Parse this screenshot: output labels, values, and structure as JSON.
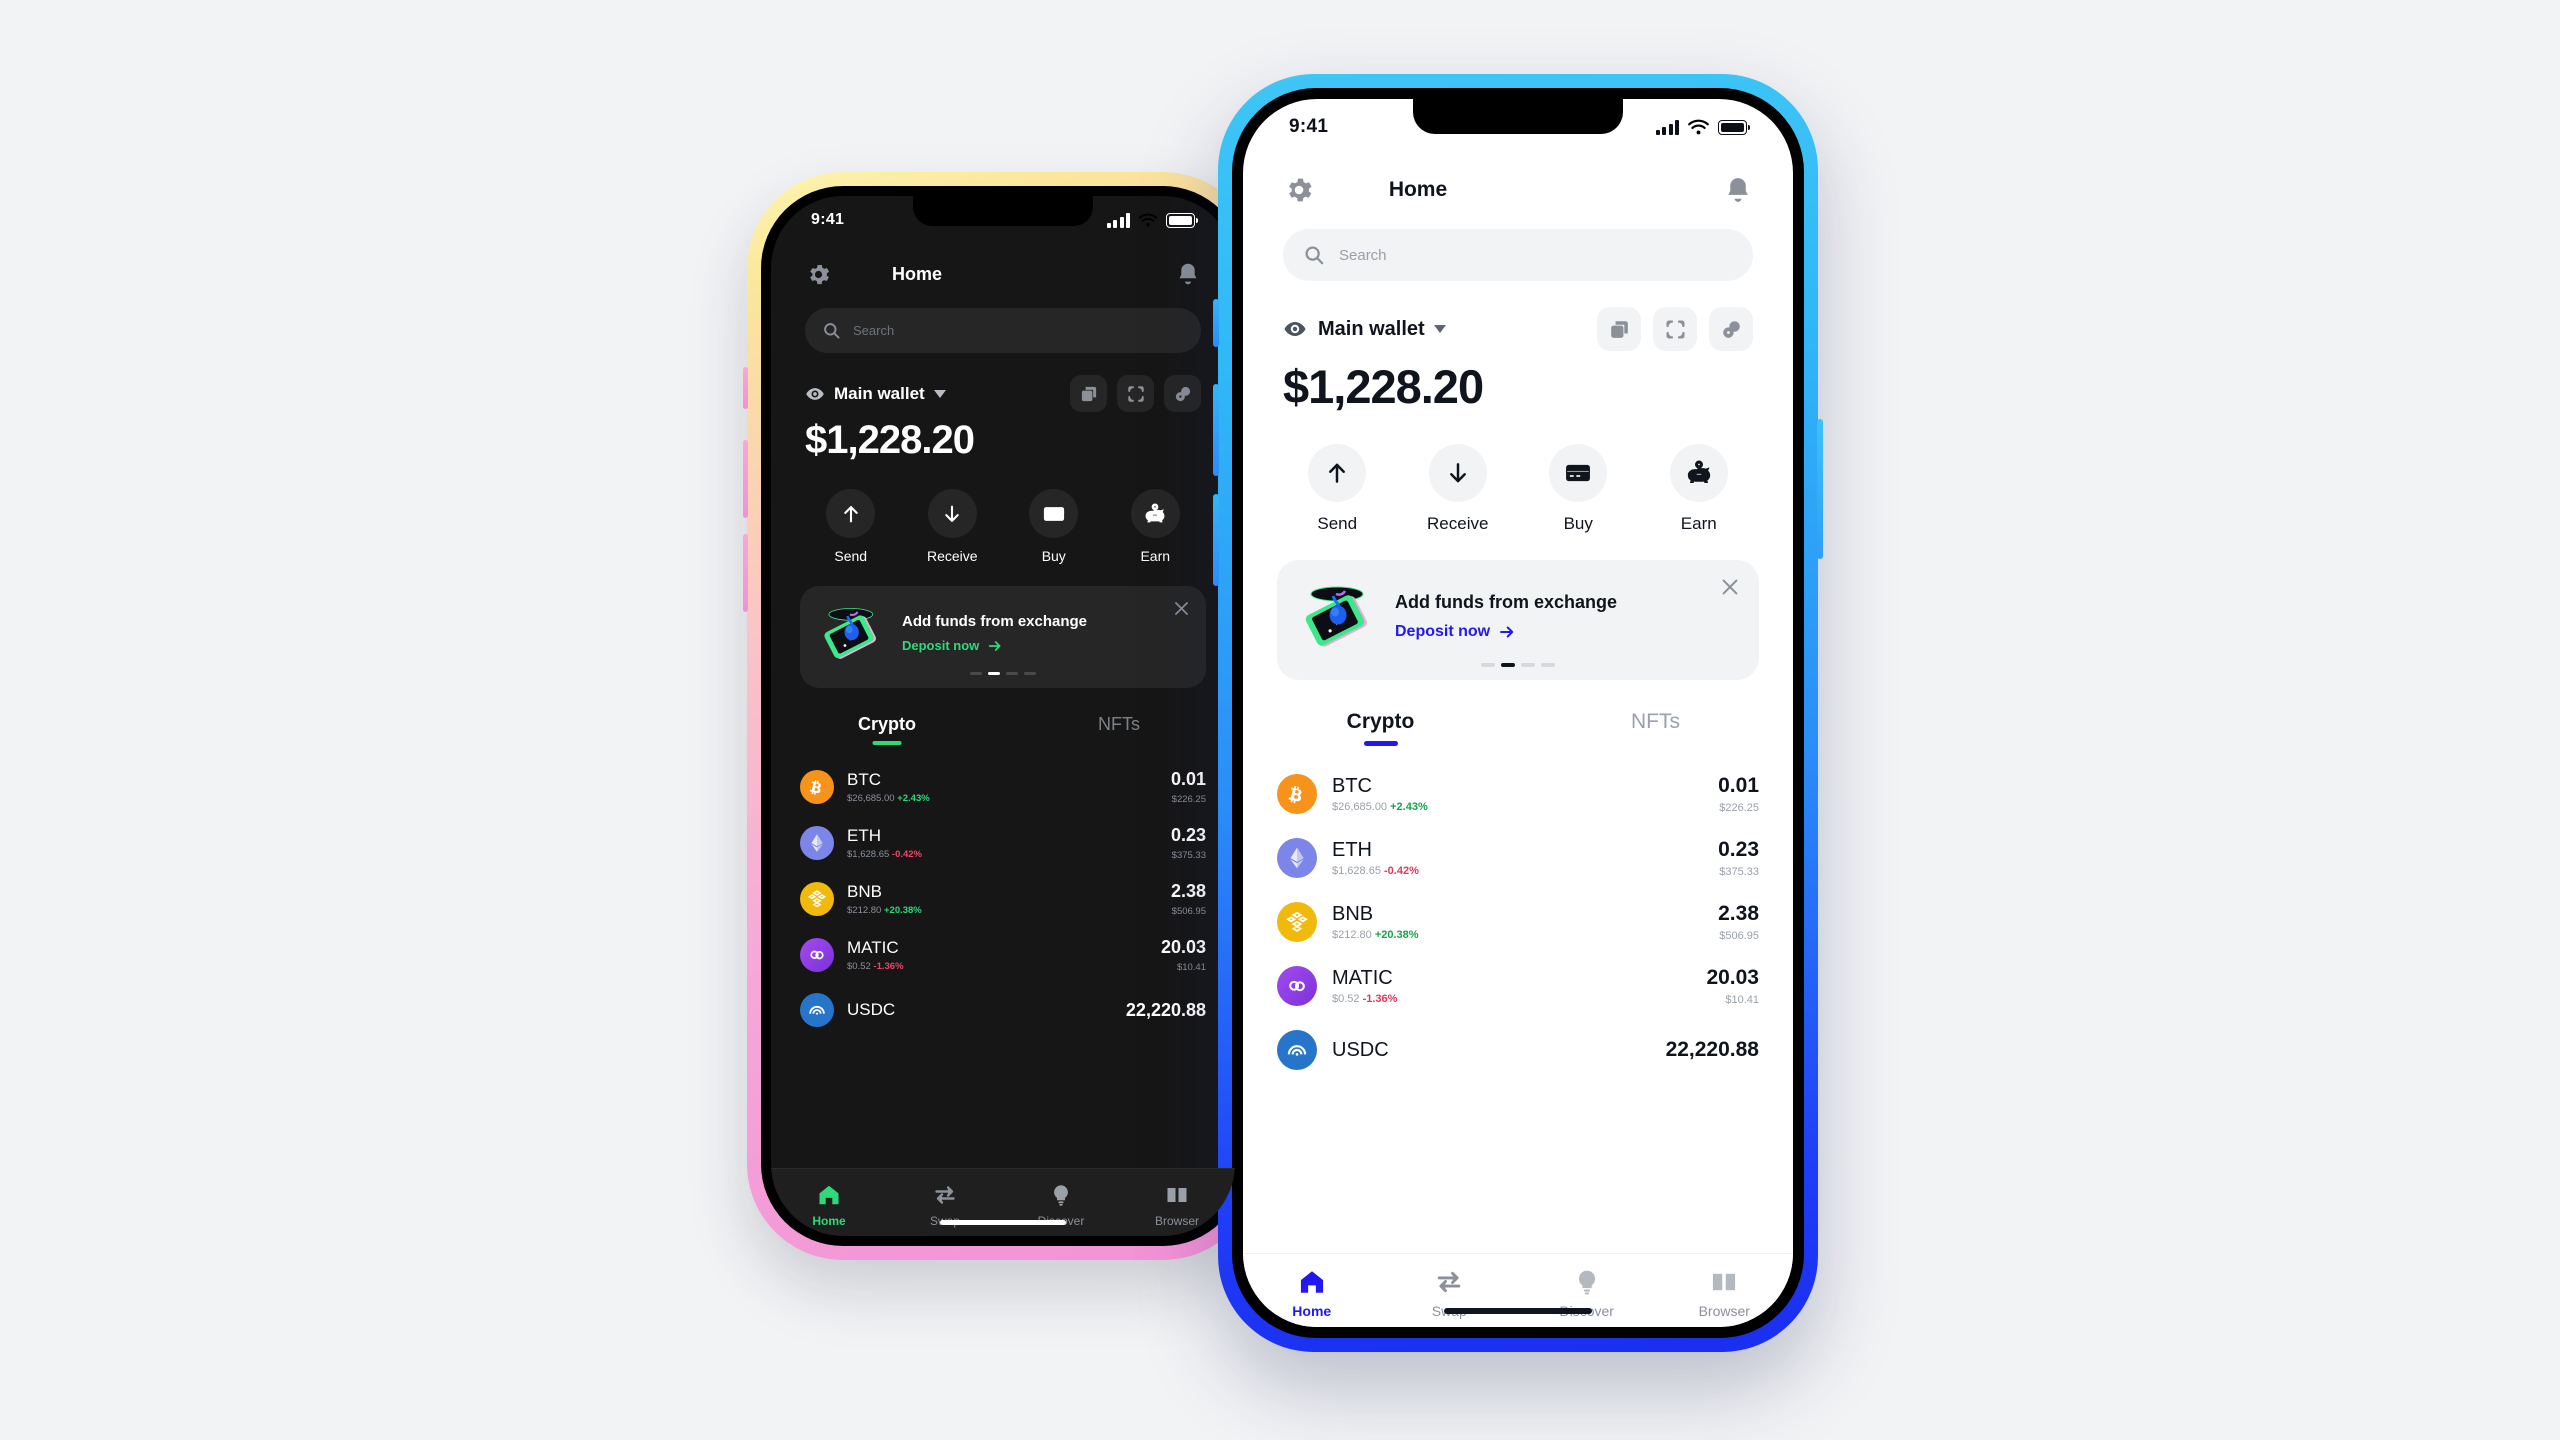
{
  "theme_colors": {
    "light_accent": "#2119ee",
    "dark_accent": "#2fd97a",
    "positive": "#16a34a",
    "negative": "#e0385a",
    "page_background": "#f2f3f5",
    "light_screen_bg": "#ffffff",
    "dark_screen_bg": "#161616",
    "dark_phone_frame": "yellow-to-pink gradient",
    "light_phone_frame": "cyan-to-blue gradient"
  },
  "status_bar": {
    "time": "9:41",
    "signal_icon": "cellular-bars-icon",
    "wifi_icon": "wifi-icon",
    "battery_icon": "battery-full-icon"
  },
  "header": {
    "title": "Home",
    "settings_icon": "gear-icon",
    "notifications_icon": "bell-icon"
  },
  "search": {
    "placeholder": "Search",
    "value": "",
    "icon": "search-icon"
  },
  "wallet": {
    "visibility_icon": "eye-icon",
    "name": "Main wallet",
    "dropdown_icon": "chevron-down-icon",
    "balance": "$1,228.20",
    "actions": [
      {
        "name": "copy-address-button",
        "icon": "copy-icon"
      },
      {
        "name": "scan-qr-button",
        "icon": "qr-scan-icon"
      },
      {
        "name": "connect-button",
        "icon": "link-connect-icon"
      }
    ]
  },
  "quick_actions": [
    {
      "label": "Send",
      "icon": "arrow-up-icon"
    },
    {
      "label": "Receive",
      "icon": "arrow-down-icon"
    },
    {
      "label": "Buy",
      "icon": "credit-card-icon"
    },
    {
      "label": "Earn",
      "icon": "piggy-bank-icon"
    }
  ],
  "promo": {
    "title": "Add funds from exchange",
    "cta": "Deposit now",
    "cta_arrow": "arrow-right-icon",
    "close_icon": "close-icon",
    "art": "phone-with-coin-illustration",
    "carousel": {
      "total": 4,
      "active_index": 1
    }
  },
  "tabs": [
    {
      "label": "Crypto",
      "active": true
    },
    {
      "label": "NFTs",
      "active": false
    }
  ],
  "tokens": [
    {
      "symbol": "BTC",
      "icon": "bitcoin-icon",
      "icon_color": "#f7931a",
      "price": "$26,685.00",
      "change": "+2.43%",
      "change_dir": "up",
      "amount": "0.01",
      "value": "$226.25"
    },
    {
      "symbol": "ETH",
      "icon": "ethereum-icon",
      "icon_color": "#7b86e8",
      "price": "$1,628.65",
      "change": "-0.42%",
      "change_dir": "down",
      "amount": "0.23",
      "value": "$375.33"
    },
    {
      "symbol": "BNB",
      "icon": "bnb-icon",
      "icon_color": "#f0b90b",
      "price": "$212.80",
      "change": "+20.38%",
      "change_dir": "up",
      "amount": "2.38",
      "value": "$506.95"
    },
    {
      "symbol": "MATIC",
      "icon": "polygon-icon",
      "icon_color": "#8247e5",
      "price": "$0.52",
      "change": "-1.36%",
      "change_dir": "down",
      "amount": "20.03",
      "value": "$10.41"
    },
    {
      "symbol": "USDC",
      "icon": "usdc-icon",
      "icon_color": "#2775ca",
      "price": "",
      "change": "",
      "change_dir": "none",
      "amount": "22,220.88",
      "value": ""
    }
  ],
  "bottom_nav": [
    {
      "label": "Home",
      "icon": "home-icon",
      "active": true
    },
    {
      "label": "Swap",
      "icon": "swap-arrows-icon",
      "active": false
    },
    {
      "label": "Discover",
      "icon": "lightbulb-icon",
      "active": false
    },
    {
      "label": "Browser",
      "icon": "book-icon",
      "active": false
    }
  ]
}
